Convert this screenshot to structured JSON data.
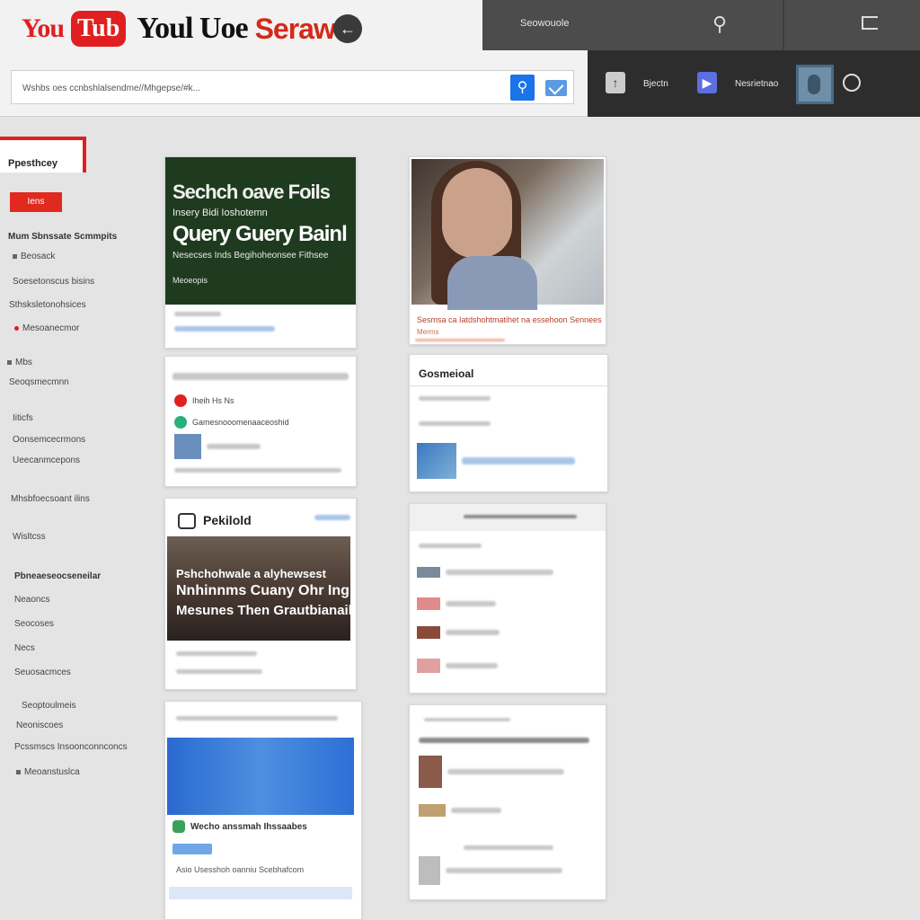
{
  "header": {
    "logo_you": "You",
    "logo_tube": "Tub",
    "title_a": "Youl Uoe",
    "title_b": "Serawol",
    "header_icon": "collapse-icon",
    "panel_label": "Seowouole",
    "panel2_label1": "Bjectn",
    "panel2_label2": "Nesrietnao"
  },
  "search": {
    "value": "Wshbs oes ccnbshlalsendme//Mhgepse/#k..."
  },
  "sidebar": {
    "title": "Ppesthcey",
    "red_button": "Iens",
    "items": [
      {
        "label": "Mum Sbnssate Scmmpits",
        "head": true
      },
      {
        "label": "Beosack"
      },
      {
        "label": "Soesetonscus bisins"
      },
      {
        "label": "Sthsksletonohsices"
      },
      {
        "label": "Mesoanecmor"
      },
      {
        "label": "Mbs"
      },
      {
        "label": "Seoqsmecmnn"
      },
      {
        "label": "Iiticfs"
      },
      {
        "label": "Oonsemcecrmons"
      },
      {
        "label": "Ueecanmcepons"
      },
      {
        "label": "Mhsbfoecsoant ilins"
      },
      {
        "label": "Wisltcss"
      },
      {
        "label": "Pbneaeseocseneilar",
        "head": true
      },
      {
        "label": "Neaoncs"
      },
      {
        "label": "Seocoses"
      },
      {
        "label": "Necs"
      },
      {
        "label": "Seuosacmces"
      },
      {
        "label": "Seoptoulmeis"
      },
      {
        "label": "Neoniscoes"
      },
      {
        "label": "Pcssmscs Insoonconnconcs"
      },
      {
        "label": "Meoanstuslca"
      }
    ]
  },
  "cards": {
    "c1": {
      "t1": "Sechch oave Foils",
      "t2": "Insery Bidi Ioshotemn",
      "t3": "Query Guery Bainl",
      "t4": "Nesecses  Inds  Begihoheonsee Fithsee",
      "t5": "Meoeopis"
    },
    "c2": {
      "caption": "Sesmsa ca Iatdshohtmatihet na essehoon Sennees",
      "caption2": "Merms"
    },
    "c3": {
      "row1": "Iheih Hs Ns",
      "row2": "Gamesnooomenaaceoshid"
    },
    "c4": {
      "title": "Gosmeioal"
    },
    "c5": {
      "title": "Pekilold",
      "t1": "Pshchohwale a alyhewsest",
      "t2": "Nnhinnms Cuany Ohr Ing",
      "t3": "Mesunes Then Grautbianaik"
    },
    "c7": {
      "row": "Wecho anssmah Ihssaabes",
      "text": "Asio Usesshoh oanniu Scebhafcom"
    }
  },
  "colors": {
    "brand_red": "#e02020",
    "accent_blue": "#1a73e8",
    "dark_panel": "#4c4c4c"
  }
}
